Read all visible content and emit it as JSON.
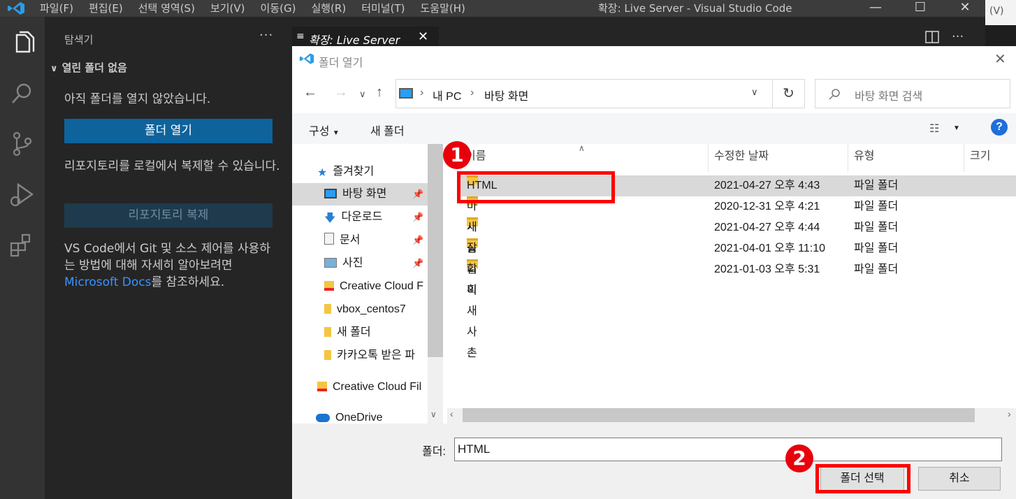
{
  "titlebar": {
    "menu": [
      "파일(F)",
      "편집(E)",
      "선택 영역(S)",
      "보기(V)",
      "이동(G)",
      "실행(R)",
      "터미널(T)",
      "도움말(H)"
    ],
    "title": "확장: Live Server - Visual Studio Code",
    "peek_text": "(V)"
  },
  "activitybar": {
    "icons": [
      "explorer-icon",
      "search-icon",
      "source-control-icon",
      "run-debug-icon",
      "extensions-icon"
    ]
  },
  "sidebar": {
    "header": "탐색기",
    "more": "···",
    "section": "열린 폴더 없음",
    "no_folder_text": "아직 폴더를 열지 않았습니다.",
    "open_folder_button": "폴더 열기",
    "clone_text": "리포지토리를 로컬에서 복제할 수 있습니다.",
    "clone_button": "리포지토리 복제",
    "docs_text_before": "VS Code에서 Git 및 소스 제어를 사용하는 방법에 대해 자세히 알아보려면 ",
    "docs_link": "Microsoft Docs",
    "docs_text_after": "를 참조하세요."
  },
  "editor": {
    "tab_label": "확장: Live Server"
  },
  "dialog": {
    "title": "폴더 열기",
    "breadcrumb": [
      "내 PC",
      "바탕 화면"
    ],
    "search_placeholder": "바탕 화면 검색",
    "toolbar": {
      "organize": "구성",
      "new_folder": "새 폴더",
      "help": "?"
    },
    "nav_items": [
      {
        "label": "즐겨찾기",
        "icon": "star-icon",
        "pinned": false
      },
      {
        "label": "바탕 화면",
        "icon": "desktop-icon",
        "pinned": true,
        "selected": true
      },
      {
        "label": "다운로드",
        "icon": "download-icon",
        "pinned": true
      },
      {
        "label": "문서",
        "icon": "document-icon",
        "pinned": true
      },
      {
        "label": "사진",
        "icon": "picture-icon",
        "pinned": true
      },
      {
        "label": "Creative Cloud F",
        "icon": "creative-cloud-icon",
        "pinned": false
      },
      {
        "label": "vbox_centos7",
        "icon": "folder-icon",
        "pinned": false
      },
      {
        "label": "새 폴더",
        "icon": "folder-icon",
        "pinned": false
      },
      {
        "label": "카카오톡 받은 파",
        "icon": "folder-icon",
        "pinned": false
      },
      {
        "label": "Creative Cloud Fil",
        "icon": "creative-cloud-icon",
        "pinned": false
      },
      {
        "label": "OneDrive",
        "icon": "onedrive-icon",
        "pinned": false
      }
    ],
    "columns": [
      "이름",
      "수정한 날짜",
      "유형",
      "크기"
    ],
    "rows": [
      {
        "name": "HTML",
        "date": "2021-04-27 오후 4:43",
        "type": "파일 폴더"
      },
      {
        "name": "마케팅 기획",
        "date": "2020-12-31 오후 4:21",
        "type": "파일 폴더"
      },
      {
        "name": "새 폴더",
        "date": "2021-04-27 오후 4:44",
        "type": "파일 폴더"
      },
      {
        "name": "잡",
        "date": "2021-04-01 오후 11:10",
        "type": "파일 폴더"
      },
      {
        "name": "할미새사촌",
        "date": "2021-01-03 오후 5:31",
        "type": "파일 폴더"
      }
    ],
    "folder_label": "폴더:",
    "folder_value": "HTML",
    "select_button": "폴더 선택",
    "cancel_button": "취소"
  },
  "annotations": {
    "step1": "1",
    "step2": "2"
  },
  "colors": {
    "vscode_blue": "#0e639c",
    "annotation_red": "#ff0000",
    "accent": "#0078d4"
  }
}
